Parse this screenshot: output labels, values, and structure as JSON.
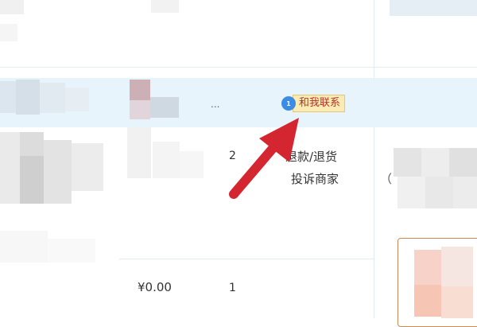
{
  "order": {
    "ellipsis": "...",
    "contact_label": "和我联系",
    "contact_badge": "1"
  },
  "item_row_1": {
    "quantity": "2",
    "actions": [
      "退款/退货",
      "投诉商家"
    ],
    "paren": "（"
  },
  "item_row_2": {
    "price": "¥0.00",
    "quantity": "1"
  },
  "colors": {
    "row_highlight": "#e8f4fc",
    "contact_bg": "#fcebb3",
    "contact_text": "#b3322c",
    "arrow": "#d42630"
  }
}
